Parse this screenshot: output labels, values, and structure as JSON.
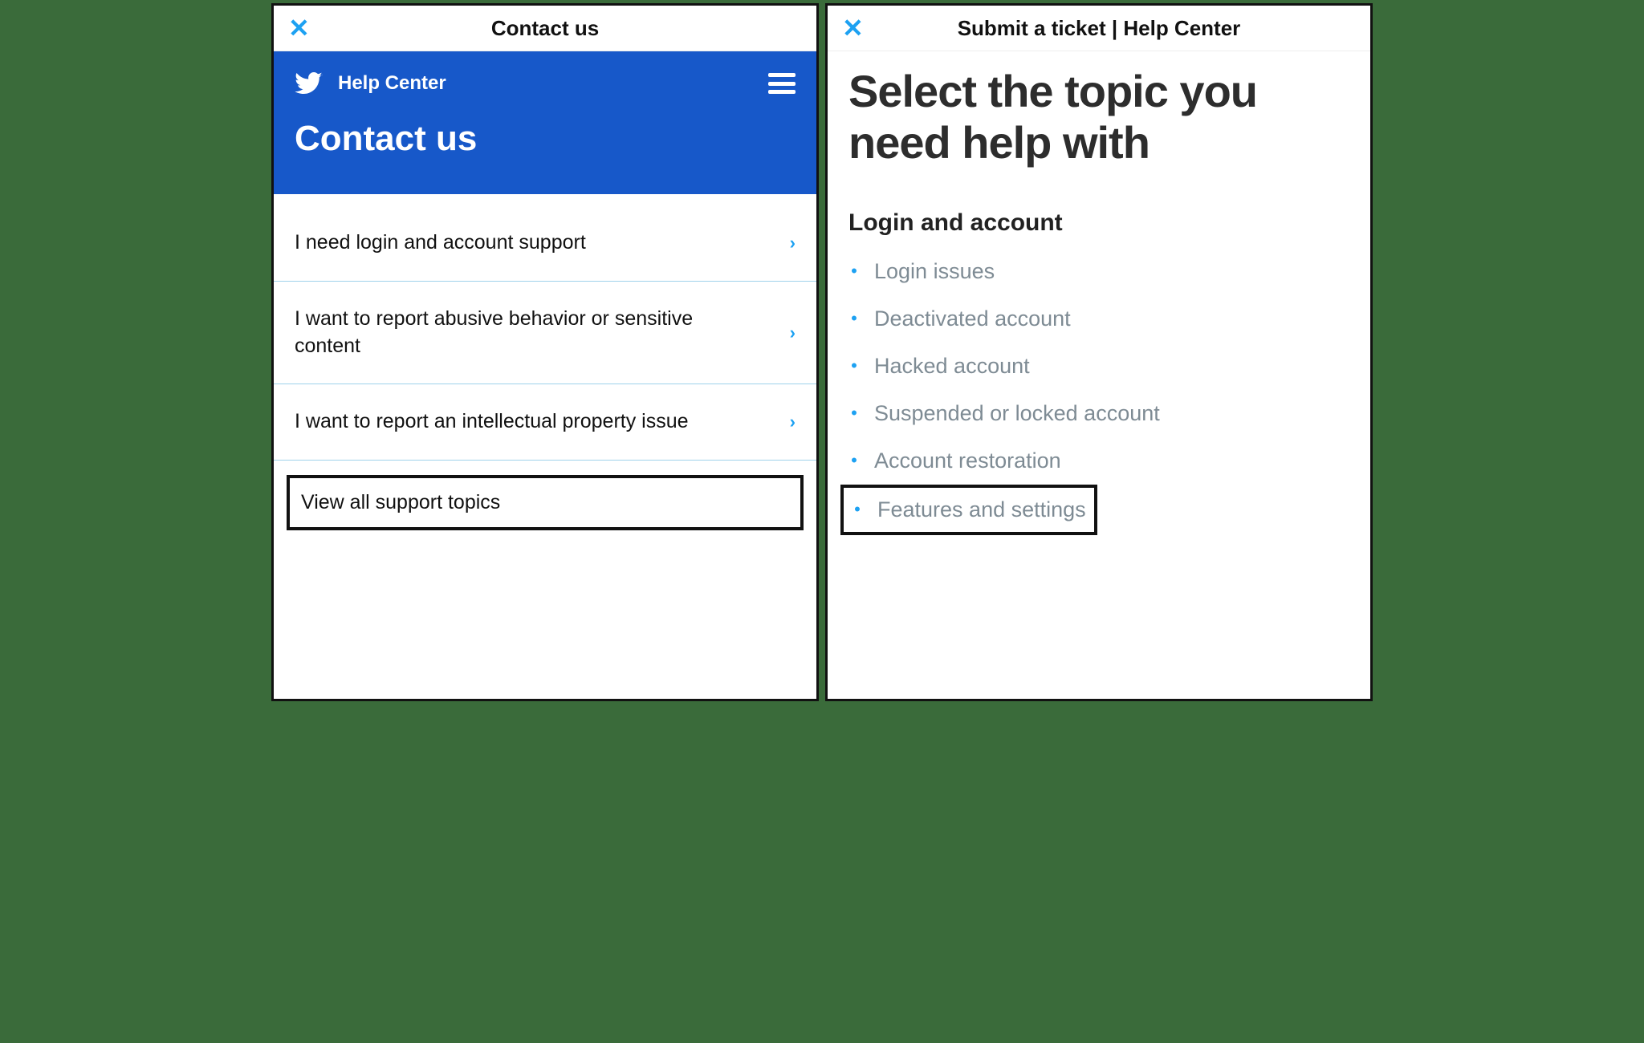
{
  "left": {
    "titlebar": {
      "title": "Contact us"
    },
    "header": {
      "brand": "Help Center",
      "heading": "Contact us"
    },
    "options": [
      {
        "label": "I need login and account support"
      },
      {
        "label": "I want to report abusive behavior or sensitive content"
      },
      {
        "label": "I want to report an intellectual property issue"
      }
    ],
    "view_all": "View all support topics"
  },
  "right": {
    "titlebar": {
      "title": "Submit a ticket | Help Center"
    },
    "heading": "Select the topic you need help with",
    "section_title": "Login and account",
    "items": [
      {
        "label": "Login issues"
      },
      {
        "label": "Deactivated account"
      },
      {
        "label": "Hacked account"
      },
      {
        "label": "Suspended or locked account"
      },
      {
        "label": "Account restoration"
      },
      {
        "label": "Features and settings"
      }
    ],
    "highlighted_index": 5
  },
  "colors": {
    "brand_blue": "#1758c9",
    "accent": "#1da1f2",
    "muted": "#7e8b94"
  }
}
